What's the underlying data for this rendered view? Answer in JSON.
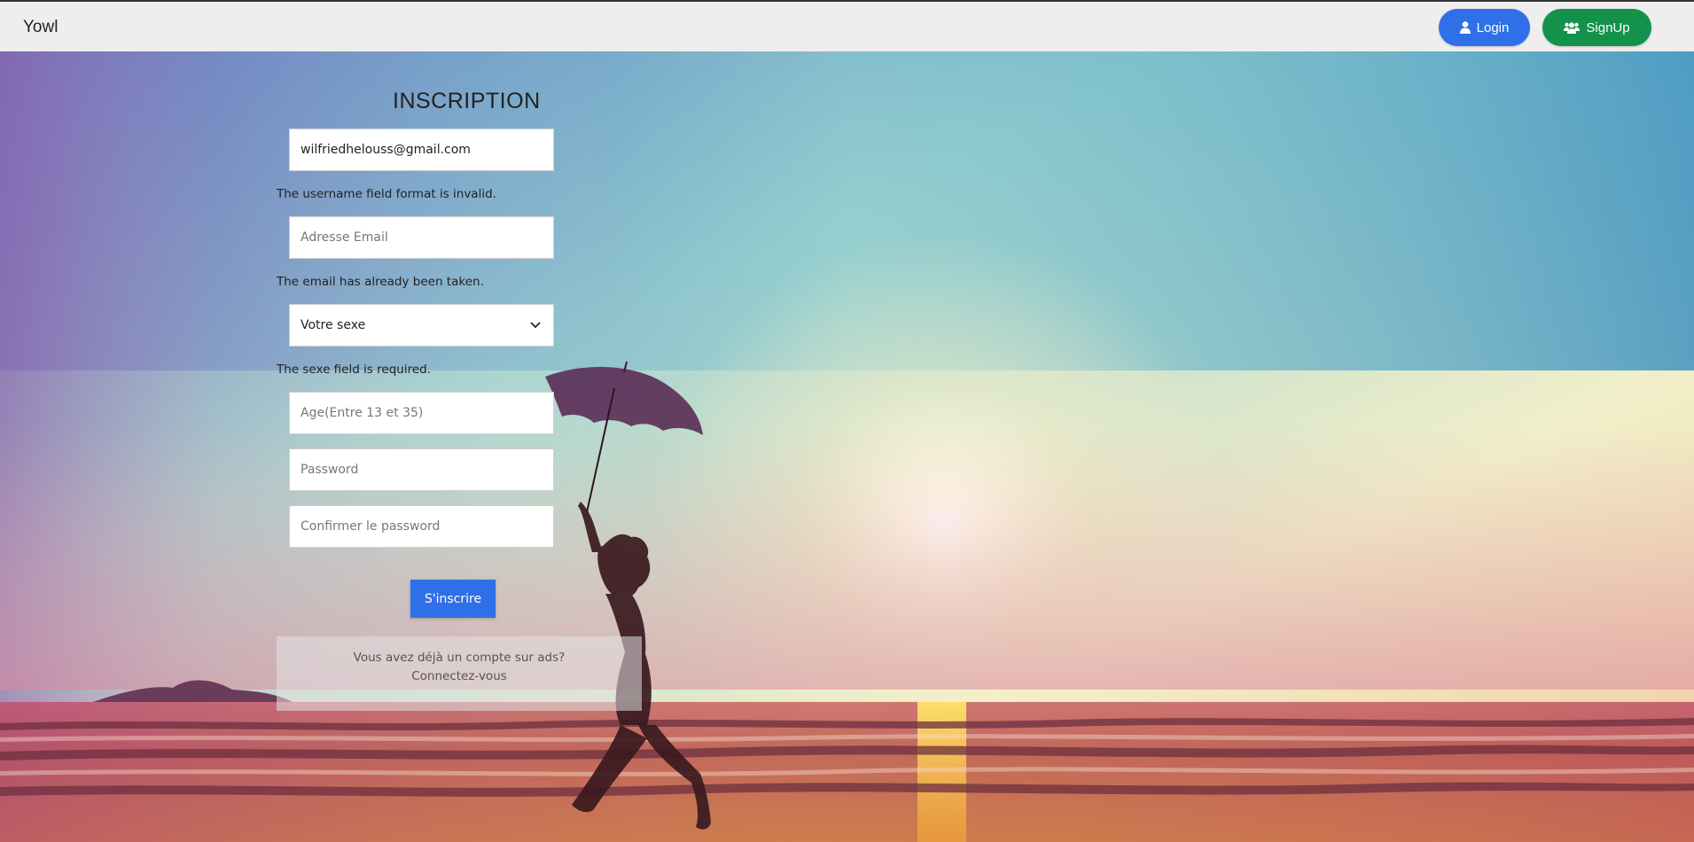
{
  "navbar": {
    "brand": "Yowl",
    "login_label": "Login",
    "signup_label": "SignUp"
  },
  "form": {
    "title": "INSCRIPTION",
    "username": {
      "value": "wilfriedhelouss@gmail.com",
      "error": "The username field format is invalid."
    },
    "email": {
      "value": "",
      "placeholder": "Adresse Email",
      "error": "The email has already been taken."
    },
    "sexe": {
      "selected": "Votre sexe",
      "error": "The sexe field is required."
    },
    "age": {
      "value": "",
      "placeholder": "Age(Entre 13 et 35)"
    },
    "password": {
      "value": "",
      "placeholder": "Password"
    },
    "confirm_password": {
      "value": "",
      "placeholder": "Confirmer le password"
    },
    "submit_label": "S'inscrire"
  },
  "login_prompt": {
    "question": "Vous avez déjà un compte sur ads?",
    "link": "Connectez-vous"
  },
  "colors": {
    "primary": "#2f6fe8",
    "success": "#14924b",
    "navbar_bg": "#eeeeee"
  },
  "icons": {
    "login": "user-icon",
    "signup": "users-icon",
    "select": "chevron-down-icon"
  }
}
